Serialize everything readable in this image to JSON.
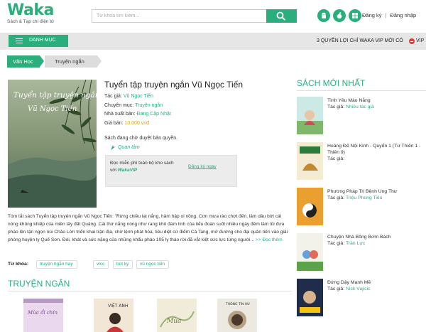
{
  "header": {
    "logo_text": "Waka",
    "logo_tagline": "Sách & Tạp chí điện tử",
    "search_placeholder": "Từ khoá tìm kiếm...",
    "platform_icons": [
      "android-icon",
      "apple-icon",
      "windows-icon"
    ],
    "register_label": "Đăng ký",
    "separator": "|",
    "login_label": "Đăng nhập"
  },
  "navbar": {
    "menu_label": "DANH MỤC",
    "promo_text": "3 QUYỀN LỢI CHỈ WAKA VIP MỚI CÓ",
    "vip_label": "VIP"
  },
  "breadcrumb": [
    "Văn Học",
    "Truyện ngắn"
  ],
  "book": {
    "title": "Tuyển tập truyện ngắn Vũ Ngọc Tiến",
    "cover_title_line1": "Tuyển tập truyện ngắn",
    "cover_title_line2": "Vũ Ngọc Tiến",
    "author_label": "Tác giả:",
    "author": "Vũ Ngọc Tiến",
    "category_label": "Chuyên mục:",
    "category": "Truyện ngắn",
    "publisher_label": "Nhà xuất bản:",
    "publisher": "Đang Cập Nhật",
    "price_label": "Giá bán:",
    "price": "10.000 vnđ",
    "status": "Sách đang chờ duyệt bản quyền.",
    "follow_label": "Quan tâm",
    "vip_line1": "Đọc miễn phí toàn bộ kho sách",
    "vip_line2_prefix": "với",
    "vip_line2_brand": "WakaVIP",
    "vip_register": "Đăng ký ngay",
    "description": "Tóm tắt sách Tuyển tập truyện ngắn Vũ Ngọc Tiến: \"Rừng chiều lạt nắng, hầm hập oi nồng. Cơn mưa rào chợt đến, lâm dâu bớt cái nóng khủng khiếp của miền tây đất Quảng. Cái thứ nắng nóng như rang khô đám lính của tiểu đoàn suốt nhiều ngày đêm lầm lũi đưa pháo lên tận ngọn núi Chảo Lớn triển khai trận địa, chờ lệnh phát hỏa, tiêu diệt cứ điểm Cà Tang, mở đường cho đại quân tiến vào giải phóng huyện lỵ Quế Sơn. Đói, khát và sức nặng của những khẩu pháo 105 ly tháo rời đã vắt kiệt sức lực từng người...",
    "read_more": ">> Đọc thêm",
    "tags_label": "Từ khóa:",
    "tags": [
      "truyện ngắn hay",
      "vlcc",
      "bút ký",
      "vũ ngọc tiến"
    ]
  },
  "section": {
    "title": "TRUYỆN NGẮN",
    "mini_covers": [
      "Mùa ổi chín",
      "VIỆT ANH",
      "Mùa",
      "THÔNG TIN HƯ"
    ]
  },
  "sidebar": {
    "title": "SÁCH MỚI NHẤT",
    "author_label": "Tác giả:",
    "items": [
      {
        "name": "Tình Yêu Màu Nắng",
        "author": "Nhiều tác giả"
      },
      {
        "name": "Hoàng Đế Nội Kinh - Quyển 1 (Từ Thiên 1 - Thiên 9)",
        "author": ""
      },
      {
        "name": "Phương Pháp Trị Bệnh Ung Thư",
        "author": "Triệu Phong Tiêu"
      },
      {
        "name": "Chuyện Nhà Bông Bơm Bách",
        "author": "Trần Lực"
      },
      {
        "name": "Đứng Dậy Mạnh Mẽ",
        "author": "Nick Vujicic"
      }
    ]
  },
  "colors": {
    "brand": "#2aaf7c",
    "price": "#e6a100",
    "vip_dot": "#e53935"
  }
}
